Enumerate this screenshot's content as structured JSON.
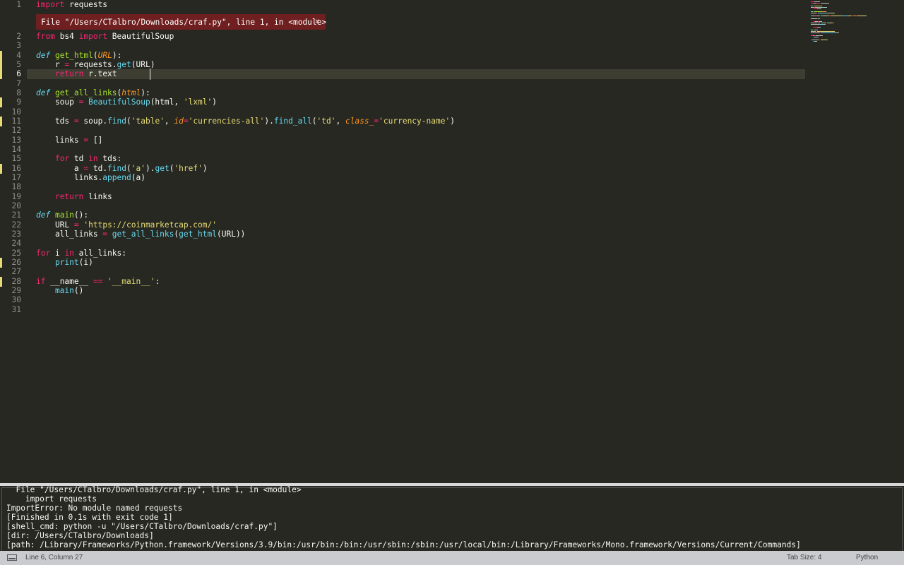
{
  "error_phantom": {
    "message": "File \"/Users/CTalbro/Downloads/craf.py\", line 1, in <module>",
    "close_label": "×"
  },
  "editor": {
    "lines": [
      {
        "n": "1",
        "mod": false,
        "tokens": [
          [
            "kw",
            "import"
          ],
          [
            "txt",
            " requests"
          ]
        ]
      },
      {
        "n": "2",
        "mod": false,
        "tokens": [
          [
            "kw",
            "from"
          ],
          [
            "txt",
            " bs4 "
          ],
          [
            "kw",
            "import"
          ],
          [
            "txt",
            " BeautifulSoup"
          ]
        ]
      },
      {
        "n": "3",
        "mod": false,
        "tokens": []
      },
      {
        "n": "4",
        "mod": true,
        "tokens": [
          [
            "def",
            "def"
          ],
          [
            "txt",
            " "
          ],
          [
            "fn",
            "get_html"
          ],
          [
            "txt",
            "("
          ],
          [
            "arg",
            "URL"
          ],
          [
            "txt",
            "):"
          ]
        ]
      },
      {
        "n": "5",
        "mod": true,
        "tokens": [
          [
            "txt",
            "    r "
          ],
          [
            "op",
            "="
          ],
          [
            "txt",
            " requests."
          ],
          [
            "call",
            "get"
          ],
          [
            "txt",
            "(URL)"
          ]
        ]
      },
      {
        "n": "6",
        "mod": true,
        "tokens": [
          [
            "txt",
            "    "
          ],
          [
            "kw",
            "return"
          ],
          [
            "txt",
            " r.text"
          ]
        ]
      },
      {
        "n": "7",
        "mod": false,
        "tokens": []
      },
      {
        "n": "8",
        "mod": false,
        "tokens": [
          [
            "def",
            "def"
          ],
          [
            "txt",
            " "
          ],
          [
            "fn",
            "get_all_links"
          ],
          [
            "txt",
            "("
          ],
          [
            "arg",
            "html"
          ],
          [
            "txt",
            "):"
          ]
        ]
      },
      {
        "n": "9",
        "mod": true,
        "tokens": [
          [
            "txt",
            "    soup "
          ],
          [
            "op",
            "="
          ],
          [
            "txt",
            " "
          ],
          [
            "call",
            "BeautifulSoup"
          ],
          [
            "txt",
            "(html, "
          ],
          [
            "str",
            "'lxml'"
          ],
          [
            "txt",
            ")"
          ]
        ]
      },
      {
        "n": "10",
        "mod": false,
        "tokens": []
      },
      {
        "n": "11",
        "mod": true,
        "tokens": [
          [
            "txt",
            "    tds "
          ],
          [
            "op",
            "="
          ],
          [
            "txt",
            " soup."
          ],
          [
            "call",
            "find"
          ],
          [
            "txt",
            "("
          ],
          [
            "str",
            "'table'"
          ],
          [
            "txt",
            ", "
          ],
          [
            "arg",
            "id"
          ],
          [
            "op",
            "="
          ],
          [
            "str",
            "'currencies-all'"
          ],
          [
            "txt",
            ")."
          ],
          [
            "call",
            "find_all"
          ],
          [
            "txt",
            "("
          ],
          [
            "str",
            "'td'"
          ],
          [
            "txt",
            ", "
          ],
          [
            "arg",
            "class_"
          ],
          [
            "op",
            "="
          ],
          [
            "str",
            "'currency-name'"
          ],
          [
            "txt",
            ")"
          ]
        ]
      },
      {
        "n": "12",
        "mod": false,
        "tokens": []
      },
      {
        "n": "13",
        "mod": false,
        "tokens": [
          [
            "txt",
            "    links "
          ],
          [
            "op",
            "="
          ],
          [
            "txt",
            " []"
          ]
        ]
      },
      {
        "n": "14",
        "mod": false,
        "tokens": []
      },
      {
        "n": "15",
        "mod": false,
        "tokens": [
          [
            "txt",
            "    "
          ],
          [
            "kw",
            "for"
          ],
          [
            "txt",
            " td "
          ],
          [
            "kw",
            "in"
          ],
          [
            "txt",
            " tds:"
          ]
        ]
      },
      {
        "n": "16",
        "mod": true,
        "tokens": [
          [
            "txt",
            "        a "
          ],
          [
            "op",
            "="
          ],
          [
            "txt",
            " td."
          ],
          [
            "call",
            "find"
          ],
          [
            "txt",
            "("
          ],
          [
            "str",
            "'a'"
          ],
          [
            "txt",
            ")."
          ],
          [
            "call",
            "get"
          ],
          [
            "txt",
            "("
          ],
          [
            "str",
            "'href'"
          ],
          [
            "txt",
            ")"
          ]
        ]
      },
      {
        "n": "17",
        "mod": false,
        "tokens": [
          [
            "txt",
            "        links."
          ],
          [
            "call",
            "append"
          ],
          [
            "txt",
            "(a)"
          ]
        ]
      },
      {
        "n": "18",
        "mod": false,
        "tokens": []
      },
      {
        "n": "19",
        "mod": false,
        "tokens": [
          [
            "txt",
            "    "
          ],
          [
            "kw",
            "return"
          ],
          [
            "txt",
            " links"
          ]
        ]
      },
      {
        "n": "20",
        "mod": false,
        "tokens": []
      },
      {
        "n": "21",
        "mod": false,
        "tokens": [
          [
            "def",
            "def"
          ],
          [
            "txt",
            " "
          ],
          [
            "fn",
            "main"
          ],
          [
            "txt",
            "():"
          ]
        ]
      },
      {
        "n": "22",
        "mod": false,
        "tokens": [
          [
            "txt",
            "    URL "
          ],
          [
            "op",
            "="
          ],
          [
            "txt",
            " "
          ],
          [
            "str",
            "'https://coinmarketcap.com/'"
          ]
        ]
      },
      {
        "n": "23",
        "mod": false,
        "tokens": [
          [
            "txt",
            "    all_links "
          ],
          [
            "op",
            "="
          ],
          [
            "txt",
            " "
          ],
          [
            "call",
            "get_all_links"
          ],
          [
            "txt",
            "("
          ],
          [
            "call",
            "get_html"
          ],
          [
            "txt",
            "(URL))"
          ]
        ]
      },
      {
        "n": "24",
        "mod": false,
        "tokens": []
      },
      {
        "n": "25",
        "mod": false,
        "tokens": [
          [
            "kw",
            "for"
          ],
          [
            "txt",
            " i "
          ],
          [
            "kw",
            "in"
          ],
          [
            "txt",
            " all_links:"
          ]
        ]
      },
      {
        "n": "26",
        "mod": true,
        "tokens": [
          [
            "txt",
            "    "
          ],
          [
            "call",
            "print"
          ],
          [
            "txt",
            "(i)"
          ]
        ]
      },
      {
        "n": "27",
        "mod": false,
        "tokens": []
      },
      {
        "n": "28",
        "mod": true,
        "tokens": [
          [
            "kw",
            "if"
          ],
          [
            "txt",
            " __name__ "
          ],
          [
            "op",
            "=="
          ],
          [
            "txt",
            " "
          ],
          [
            "str",
            "'__main__'"
          ],
          [
            "txt",
            ":"
          ]
        ]
      },
      {
        "n": "29",
        "mod": false,
        "tokens": [
          [
            "txt",
            "    "
          ],
          [
            "call",
            "main"
          ],
          [
            "txt",
            "()"
          ]
        ]
      },
      {
        "n": "30",
        "mod": false,
        "tokens": []
      },
      {
        "n": "31",
        "mod": false,
        "tokens": []
      }
    ],
    "current_line": "6"
  },
  "output": {
    "lines": [
      "  File \"/Users/CTalbro/Downloads/craf.py\", line 1, in <module>",
      "    import requests",
      "ImportError: No module named requests",
      "[Finished in 0.1s with exit code 1]",
      "[shell_cmd: python -u \"/Users/CTalbro/Downloads/craf.py\"]",
      "[dir: /Users/CTalbro/Downloads]",
      "[path: /Library/Frameworks/Python.framework/Versions/3.9/bin:/usr/bin:/bin:/usr/sbin:/sbin:/usr/local/bin:/Library/Frameworks/Mono.framework/Versions/Current/Commands]"
    ]
  },
  "statusbar": {
    "position": "Line 6, Column 27",
    "tab_size": "Tab Size: 4",
    "syntax": "Python"
  },
  "colors": {
    "background": "#272822",
    "keyword": "#f92672",
    "function": "#a6e22e",
    "builtin": "#66d9ef",
    "argument": "#fd971f",
    "string": "#e6db74",
    "error_phantom": "#6f1f1f"
  }
}
